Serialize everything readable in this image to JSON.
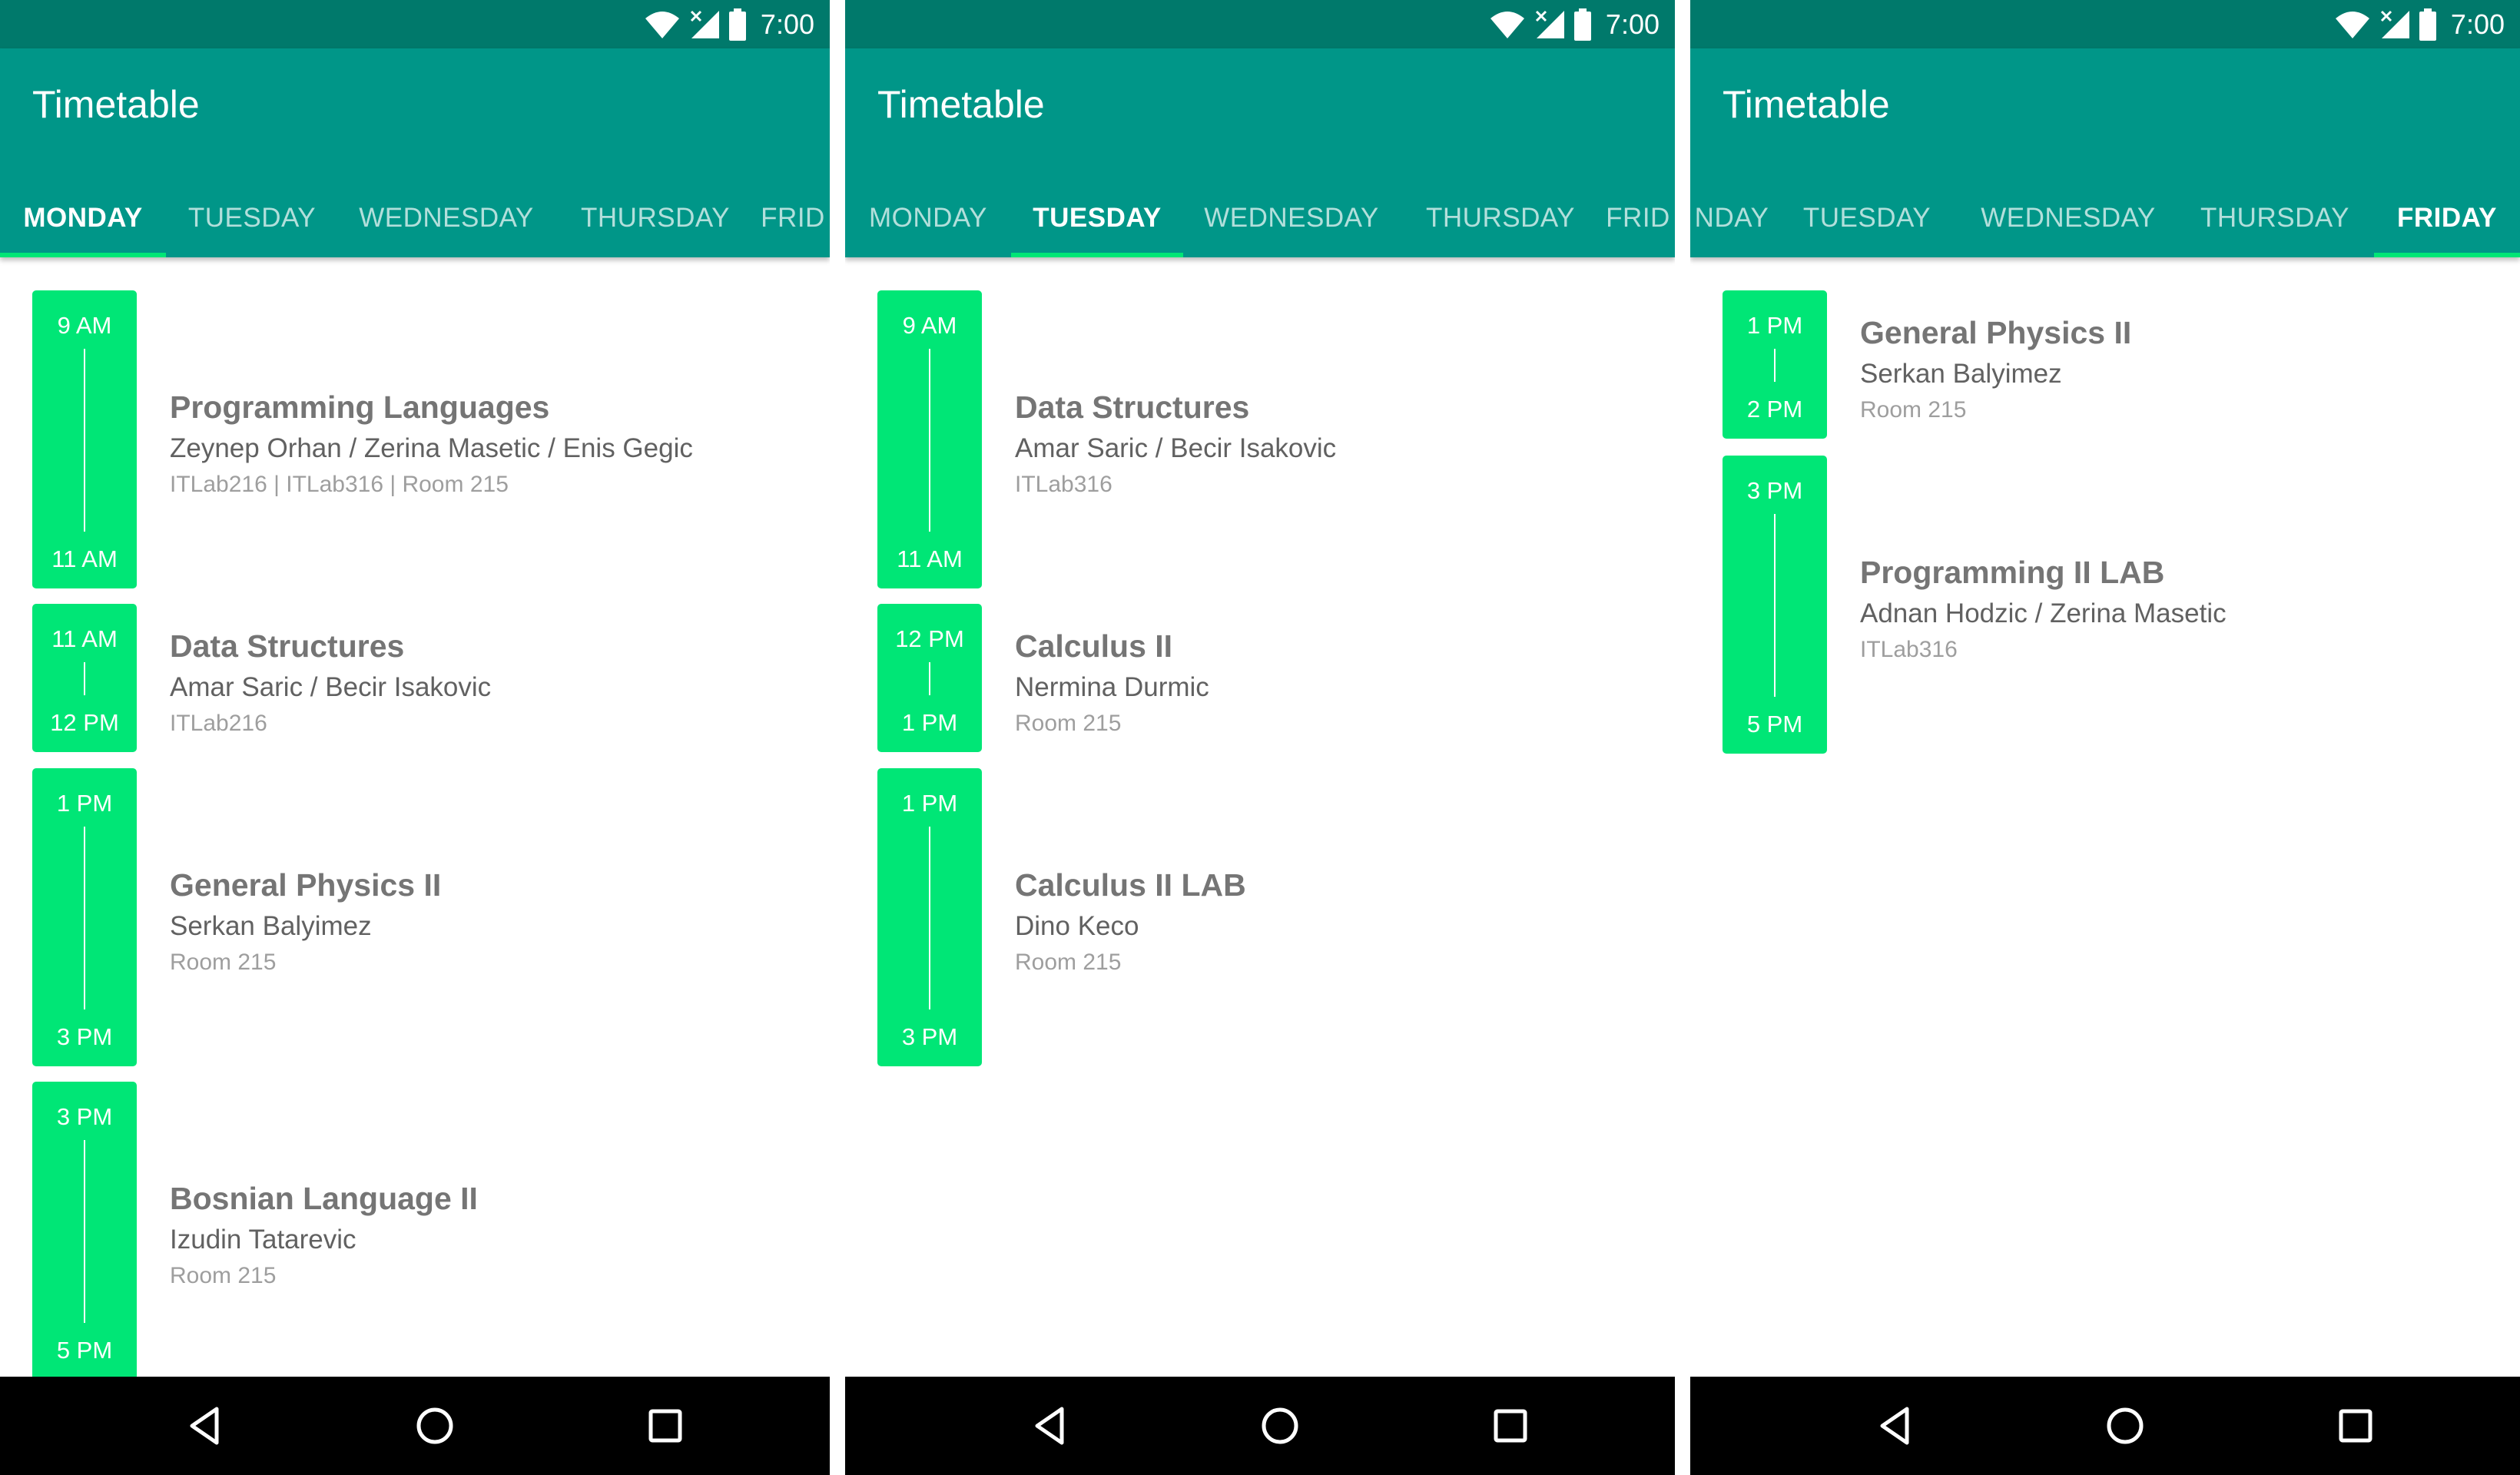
{
  "colors": {
    "status_bar": "#00796b",
    "app_bar": "#009688",
    "accent": "#00e676",
    "tab_inactive": "#b2dfdb",
    "nav_bar": "#000000"
  },
  "screens": [
    {
      "status": {
        "time": "7:00",
        "icons": [
          "wifi-icon",
          "no-signal-icon",
          "battery-icon"
        ]
      },
      "title": "Timetable",
      "tabs": [
        "MONDAY",
        "TUESDAY",
        "WEDNESDAY",
        "THURSDAY",
        "FRID"
      ],
      "active_tab": "MONDAY",
      "lessons": [
        {
          "start": "9 AM",
          "end": "11 AM",
          "subject": "Programming Languages",
          "teachers": "Zeynep Orhan / Zerina Masetic / Enis Gegic",
          "room": "ITLab216 | ITLab316 | Room 215"
        },
        {
          "start": "11 AM",
          "end": "12 PM",
          "subject": "Data Structures",
          "teachers": "Amar Saric / Becir Isakovic",
          "room": "ITLab216"
        },
        {
          "start": "1 PM",
          "end": "3 PM",
          "subject": "General Physics II",
          "teachers": "Serkan Balyimez",
          "room": "Room 215"
        },
        {
          "start": "3 PM",
          "end": "5 PM",
          "subject": "Bosnian Language II",
          "teachers": "Izudin Tatarevic",
          "room": "Room 215"
        }
      ],
      "nav": [
        "back-icon",
        "home-icon",
        "recents-icon"
      ]
    },
    {
      "status": {
        "time": "7:00",
        "icons": [
          "wifi-icon",
          "no-signal-icon",
          "battery-icon"
        ]
      },
      "title": "Timetable",
      "tabs": [
        "MONDAY",
        "TUESDAY",
        "WEDNESDAY",
        "THURSDAY",
        "FRID"
      ],
      "active_tab": "TUESDAY",
      "lessons": [
        {
          "start": "9 AM",
          "end": "11 AM",
          "subject": "Data Structures",
          "teachers": "Amar Saric / Becir Isakovic",
          "room": "ITLab316"
        },
        {
          "start": "12 PM",
          "end": "1 PM",
          "subject": "Calculus II",
          "teachers": "Nermina Durmic",
          "room": "Room 215"
        },
        {
          "start": "1 PM",
          "end": "3 PM",
          "subject": "Calculus II LAB",
          "teachers": "Dino Keco",
          "room": "Room 215"
        }
      ],
      "nav": [
        "back-icon",
        "home-icon",
        "recents-icon"
      ]
    },
    {
      "status": {
        "time": "7:00",
        "icons": [
          "wifi-icon",
          "no-signal-icon",
          "battery-icon"
        ]
      },
      "title": "Timetable",
      "tabs": [
        "NDAY",
        "TUESDAY",
        "WEDNESDAY",
        "THURSDAY",
        "FRIDAY"
      ],
      "active_tab": "FRIDAY",
      "lessons": [
        {
          "start": "1 PM",
          "end": "2 PM",
          "subject": "General Physics II",
          "teachers": "Serkan Balyimez",
          "room": "Room 215"
        },
        {
          "start": "3 PM",
          "end": "5 PM",
          "subject": "Programming II LAB",
          "teachers": "Adnan Hodzic / Zerina Masetic",
          "room": "ITLab316"
        }
      ],
      "nav": [
        "back-icon",
        "home-icon",
        "recents-icon"
      ]
    }
  ]
}
